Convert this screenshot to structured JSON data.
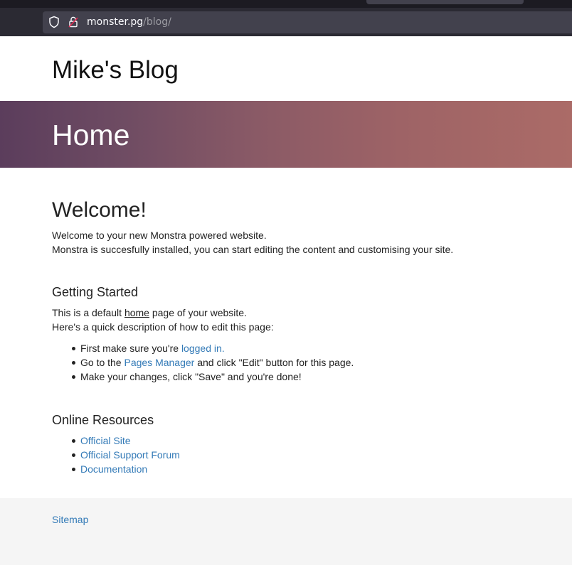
{
  "browser": {
    "url_host": "monster.pg",
    "url_path": "/blog/"
  },
  "site": {
    "title": "Mike's Blog",
    "page_heading": "Home"
  },
  "content": {
    "welcome_heading": "Welcome!",
    "intro_line1": "Welcome to your new Monstra powered website.",
    "intro_line2": "Monstra is succesfully installed, you can start editing the content and customising your site.",
    "getting_started": {
      "heading": "Getting Started",
      "line1_before": "This is a default ",
      "line1_link": "home",
      "line1_after": " page of your website.",
      "line2": "Here's a quick description of how to edit this page:",
      "steps": [
        {
          "before": "First make sure you're ",
          "link": "logged in.",
          "after": ""
        },
        {
          "before": "Go to the ",
          "link": "Pages Manager",
          "after": " and click \"Edit\" button for this page."
        },
        {
          "before": "Make your changes, click \"Save\" and you're done!",
          "link": "",
          "after": ""
        }
      ]
    },
    "online_resources": {
      "heading": "Online Resources",
      "links": [
        "Official Site",
        "Official Support Forum",
        "Documentation"
      ]
    }
  },
  "footer": {
    "sitemap_label": "Sitemap"
  },
  "colors": {
    "link": "#337ab7",
    "hero_gradient_start": "#5b3d5c",
    "hero_gradient_end": "#ab6b67",
    "footer_bg": "#f5f5f5"
  }
}
